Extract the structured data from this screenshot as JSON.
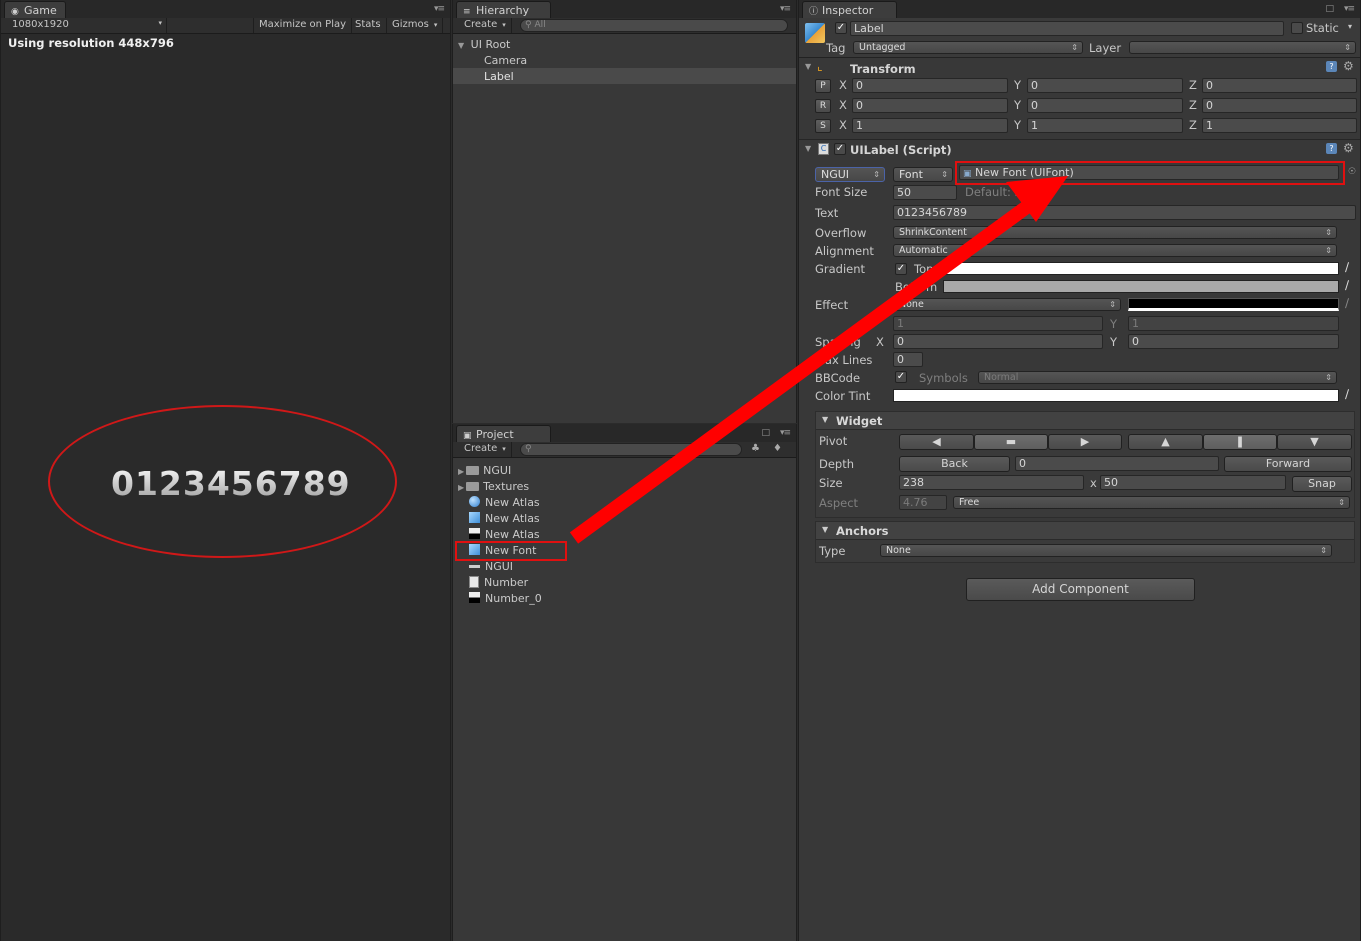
{
  "game": {
    "tab_title": "Game",
    "resolution_dropdown": "1080x1920",
    "maximize": "Maximize on Play",
    "stats": "Stats",
    "gizmos": "Gizmos",
    "using_resolution": "Using resolution 448x796",
    "preview_text": "0123456789"
  },
  "hierarchy": {
    "tab_title": "Hierarchy",
    "create": "Create",
    "search_placeholder": "All",
    "items": [
      "UI Root",
      "Camera",
      "Label"
    ]
  },
  "project": {
    "tab_title": "Project",
    "create": "Create",
    "items": [
      {
        "label": "NGUI",
        "icon": "folder-icon"
      },
      {
        "label": "Textures",
        "icon": "folder-icon"
      },
      {
        "label": "New Atlas",
        "icon": "material-sphere-icon"
      },
      {
        "label": "New Atlas",
        "icon": "prefab-cube-icon"
      },
      {
        "label": "New Atlas",
        "icon": "texture-icon"
      },
      {
        "label": "New Font",
        "icon": "prefab-cube-icon"
      },
      {
        "label": "NGUI",
        "icon": "font-icon"
      },
      {
        "label": "Number",
        "icon": "text-file-icon"
      },
      {
        "label": "Number_0",
        "icon": "texture-icon"
      }
    ]
  },
  "inspector": {
    "tab_title": "Inspector",
    "object_name": "Label",
    "static_label": "Static",
    "tag_label": "Tag",
    "tag_value": "Untagged",
    "layer_label": "Layer",
    "layer_value": "",
    "transform": {
      "title": "Transform",
      "rows": [
        {
          "btn": "P",
          "x": "0",
          "y": "0",
          "z": "0"
        },
        {
          "btn": "R",
          "x": "0",
          "y": "0",
          "z": "0"
        },
        {
          "btn": "S",
          "x": "1",
          "y": "1",
          "z": "1"
        }
      ],
      "axis_x": "X",
      "axis_y": "Y",
      "axis_z": "Z"
    },
    "uilabel": {
      "title": "UILabel (Script)",
      "font_type": "NGUI",
      "font_dd": "Font",
      "font_value": "New Font (UIFont)",
      "font_size_label": "Font Size",
      "font_size": "50",
      "font_size_default": "Default: 32",
      "text_label": "Text",
      "text_value": "0123456789",
      "overflow_label": "Overflow",
      "overflow_value": "ShrinkContent",
      "alignment_label": "Alignment",
      "alignment_value": "Automatic",
      "gradient_label": "Gradient",
      "gradient_top": "Top",
      "gradient_bottom": "Bottom",
      "effect_label": "Effect",
      "effect_value": "None",
      "effect_x": "1",
      "effect_y_label": "Y",
      "effect_y": "1",
      "spacing_label": "Spacing",
      "spacing_x_label": "X",
      "spacing_x": "0",
      "spacing_y_label": "Y",
      "spacing_y": "0",
      "maxlines_label": "Max Lines",
      "maxlines": "0",
      "bbcode_label": "BBCode",
      "symbols_label": "Symbols",
      "symbols_value": "Normal",
      "colortint_label": "Color Tint"
    },
    "widget": {
      "title": "Widget",
      "pivot_label": "Pivot",
      "depth_label": "Depth",
      "back": "Back",
      "depth": "0",
      "forward": "Forward",
      "size_label": "Size",
      "size_w": "238",
      "size_x": "x",
      "size_h": "50",
      "snap": "Snap",
      "aspect_label": "Aspect",
      "aspect": "4.76",
      "aspect_mode": "Free"
    },
    "anchors": {
      "title": "Anchors",
      "type_label": "Type",
      "type_value": "None"
    },
    "add_component": "Add Component"
  },
  "colors": {
    "annotation_red": "#ff0000",
    "selection": "#4a4a4a"
  }
}
